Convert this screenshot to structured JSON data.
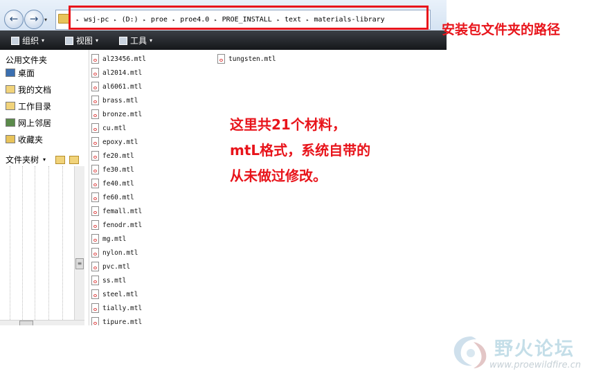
{
  "address_bar": {
    "back_glyph": "←",
    "forward_glyph": "→",
    "dropdown_glyph": "▾",
    "separator_glyph": "▸",
    "breadcrumbs": [
      "wsj-pc",
      "(D:)",
      "proe",
      "proe4.0",
      "PROE_INSTALL",
      "text",
      "materials-library"
    ]
  },
  "toolbar": {
    "organize_label": "组织",
    "views_label": "视图",
    "tools_label": "工具",
    "arrow_glyph": "▾"
  },
  "sidebar": {
    "favorites_title": "公用文件夹",
    "favorites": [
      {
        "label": "桌面",
        "icon": "desktop-icon"
      },
      {
        "label": "我的文档",
        "icon": "documents-icon"
      },
      {
        "label": "工作目录",
        "icon": "working-directory-icon"
      },
      {
        "label": "网上邻居",
        "icon": "network-icon"
      },
      {
        "label": "收藏夹",
        "icon": "favorites-icon"
      }
    ],
    "folder_tree_label": "文件夹树",
    "folder_tree_arrow": "▾"
  },
  "files": {
    "column1": [
      "al23456.mtl",
      "al2014.mtl",
      "al6061.mtl",
      "brass.mtl",
      "bronze.mtl",
      "cu.mtl",
      "epoxy.mtl",
      "fe20.mtl",
      "fe30.mtl",
      "fe40.mtl",
      "fe60.mtl",
      "femall.mtl",
      "fenodr.mtl",
      "mg.mtl",
      "nylon.mtl",
      "pvc.mtl",
      "ss.mtl",
      "steel.mtl",
      "tially.mtl",
      "tipure.mtl"
    ],
    "column2": [
      "tungsten.mtl"
    ]
  },
  "annotations": {
    "path_note": "安装包文件夹的路径",
    "body_lines": [
      "这里共21个材料，",
      "mtL格式，系统自带的",
      "从未做过修改。"
    ],
    "color": "#e8141b"
  },
  "watermark": {
    "name": "野火论坛",
    "url": "www.proewildfire.cn"
  }
}
